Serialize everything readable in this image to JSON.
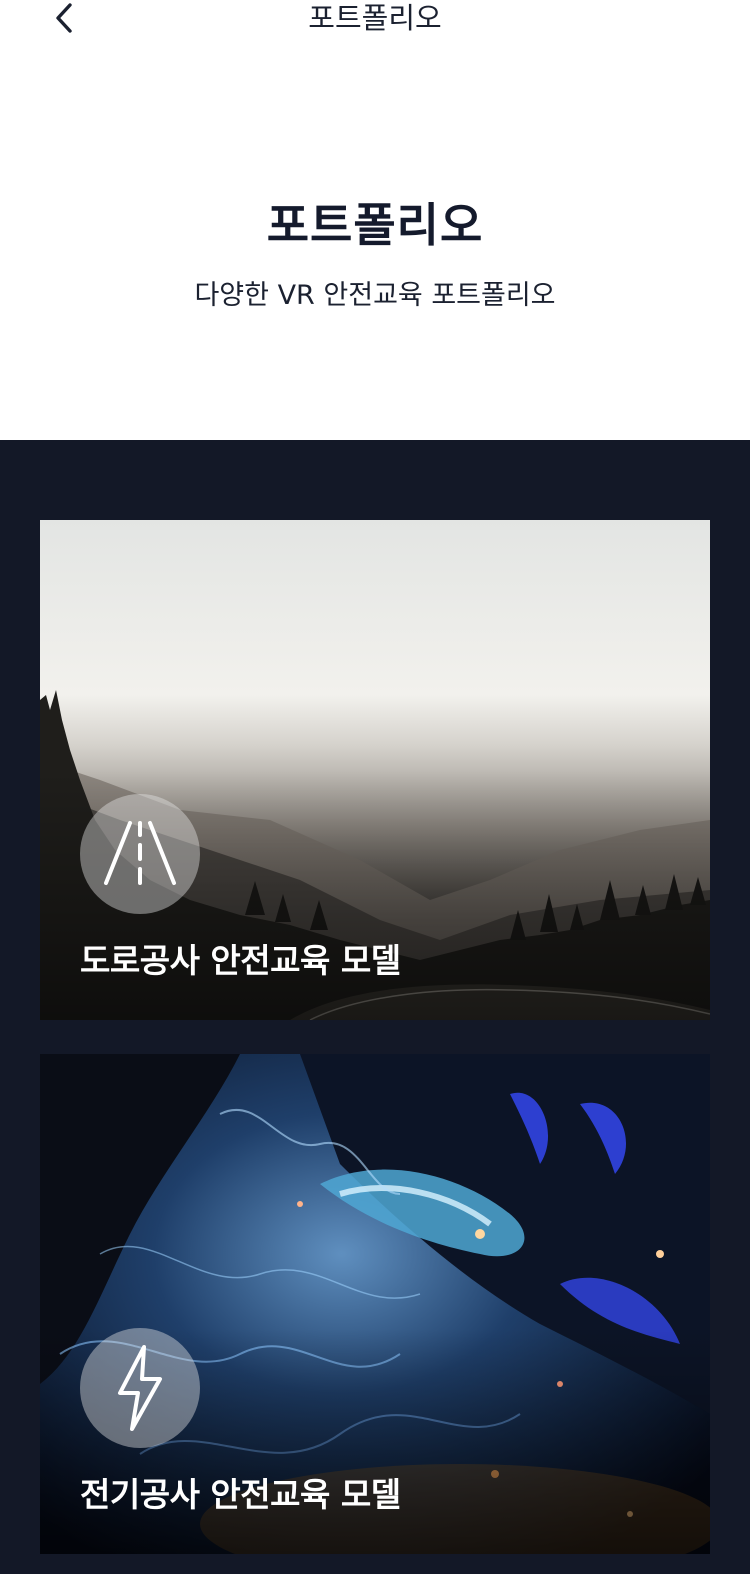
{
  "nav": {
    "title": "포트폴리오",
    "back_icon": "chevron-left-icon"
  },
  "hero": {
    "title": "포트폴리오",
    "subtitle": "다양한 VR 안전교육 포트폴리오"
  },
  "portfolio": {
    "items": [
      {
        "label": "도로공사 안전교육 모델",
        "icon": "road-icon"
      },
      {
        "label": "전기공사 안전교육 모델",
        "icon": "lightning-icon"
      }
    ]
  },
  "colors": {
    "dark_background": "#131827",
    "title_text": "#141a2c",
    "card_label": "#ffffff"
  }
}
